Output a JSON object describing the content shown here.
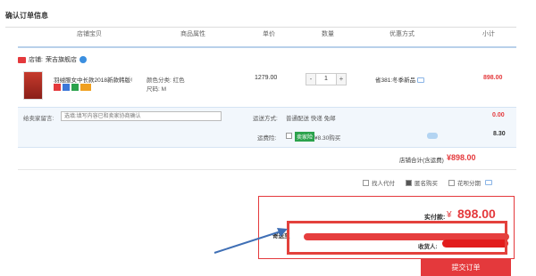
{
  "page": {
    "title": "确认订单信息"
  },
  "columns": [
    "店铺宝贝",
    "商品属性",
    "单价",
    "数量",
    "优惠方式",
    "小计"
  ],
  "shop": {
    "label": "店铺:",
    "name": "荣吉旗舰店"
  },
  "item": {
    "title": "羽绒服女中长款2018新款韩版冬",
    "color": "颜色分类: 红色",
    "size": "尺码: M",
    "price": "1279.00",
    "quantity": "1",
    "promo": "省381:冬季新品",
    "subtotal": "898.00"
  },
  "message": {
    "label": "给卖家留言:",
    "placeholder": "选填:填写内容已和卖家协商确认"
  },
  "shipping": {
    "label": "运送方式:",
    "method": "普通配送 快递 免邮",
    "fee": "0.00"
  },
  "insurance": {
    "label": "运费险:",
    "tag": "卖家险",
    "text": "¥8.30购买",
    "amount": "8.30"
  },
  "store_total": {
    "label": "店铺合计(含运费)",
    "amount": "¥898.00"
  },
  "options": [
    {
      "label": "找人代付",
      "checked": false
    },
    {
      "label": "匿名购买",
      "checked": true
    },
    {
      "label": "花呗分期",
      "checked": false
    }
  ],
  "summary": {
    "paid_label": "实付款:",
    "currency": "¥",
    "paid_amount": "898.00",
    "send_to_label": "寄送至",
    "receiver_label": "收货人:"
  },
  "submit_label": "提交订单",
  "colors": {
    "accent": "#e4393c",
    "annotation": "#e3413c"
  }
}
